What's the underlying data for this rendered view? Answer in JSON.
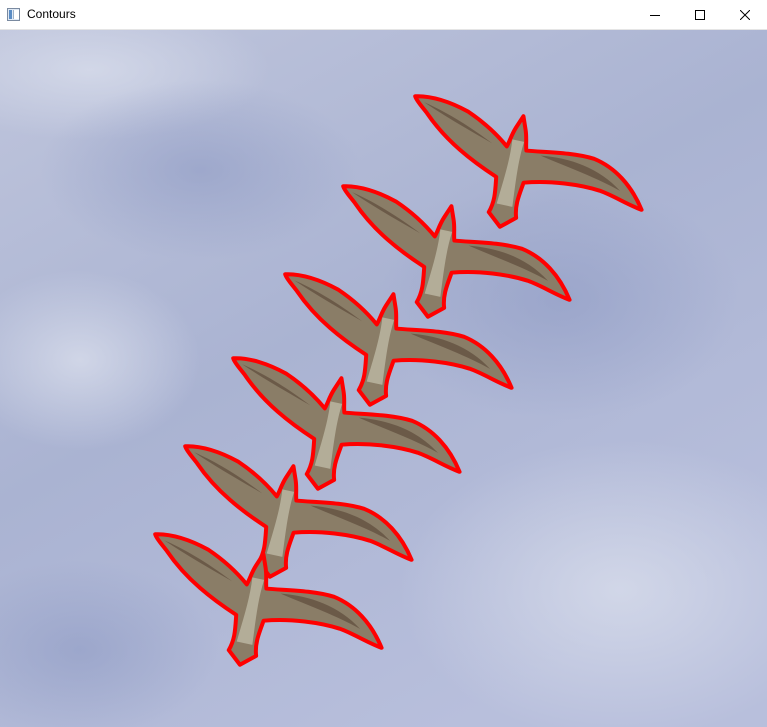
{
  "window": {
    "title": "Contours",
    "controls": {
      "minimize": "minimize-icon",
      "maximize": "maximize-icon",
      "close": "close-icon"
    }
  },
  "canvas": {
    "sky_color": "#b4bcd8",
    "contour_color": "#ff0000",
    "bird_body_color": "#9a9078",
    "bird_wing_color": "#7d6a55",
    "bird_count": 6
  }
}
